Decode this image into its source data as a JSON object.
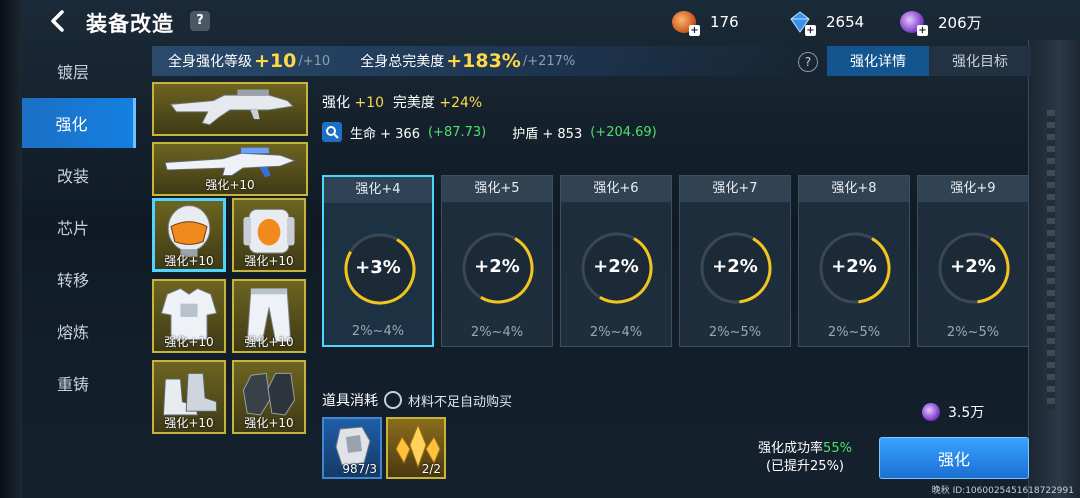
{
  "header": {
    "back_icon": "back-arrow-icon",
    "title": "装备改造",
    "help": "?",
    "currencies": [
      {
        "icon": "copper-ore-icon",
        "value": "176"
      },
      {
        "icon": "blue-crystal-icon",
        "value": "2654"
      },
      {
        "icon": "purple-orb-icon",
        "value": "206万"
      }
    ]
  },
  "sidebar": {
    "items": [
      {
        "label": "镀层"
      },
      {
        "label": "强化"
      },
      {
        "label": "改装"
      },
      {
        "label": "芯片"
      },
      {
        "label": "转移"
      },
      {
        "label": "熔炼"
      },
      {
        "label": "重铸"
      }
    ],
    "active_index": 1
  },
  "summary": {
    "level_label": "全身强化等级",
    "level_value": "+10",
    "level_max": "/+10",
    "perfect_label": "全身总完美度",
    "perfect_value": "+183%",
    "perfect_max": "/+217%"
  },
  "tabs": {
    "help": "?",
    "items": [
      {
        "label": "强化详情"
      },
      {
        "label": "强化目标"
      }
    ]
  },
  "equipment": [
    {
      "type": "rifle",
      "label": ""
    },
    {
      "type": "sniper",
      "label": "强化+10"
    },
    {
      "type": "helmet",
      "label": "强化+10"
    },
    {
      "type": "backpack",
      "label": "强化+10"
    },
    {
      "type": "armor",
      "label": "强化+10"
    },
    {
      "type": "pants",
      "label": "强化+10"
    },
    {
      "type": "boots",
      "label": "强化+10"
    },
    {
      "type": "gloves",
      "label": "强化+10"
    }
  ],
  "detail": {
    "enh_label": "强化",
    "enh_value": "+10",
    "perfect_label": "完美度",
    "perfect_value": "+24%",
    "hp_label": "生命 + 366",
    "hp_bonus": "(+87.73)",
    "shield_label": "护盾 + 853",
    "shield_bonus": "(+204.69)"
  },
  "cards": [
    {
      "title": "强化+4",
      "pct": "+3%",
      "range": "2%~4%",
      "progress": 0.75
    },
    {
      "title": "强化+5",
      "pct": "+2%",
      "range": "2%~4%",
      "progress": 0.5
    },
    {
      "title": "强化+6",
      "pct": "+2%",
      "range": "2%~4%",
      "progress": 0.5
    },
    {
      "title": "强化+7",
      "pct": "+2%",
      "range": "2%~5%",
      "progress": 0.4
    },
    {
      "title": "强化+8",
      "pct": "+2%",
      "range": "2%~5%",
      "progress": 0.4
    },
    {
      "title": "强化+9",
      "pct": "+2%",
      "range": "2%~5%",
      "progress": 0.4
    }
  ],
  "consume": {
    "label": "道具消耗",
    "auto_buy": "材料不足自动购买",
    "items": [
      {
        "icon": "armor-plate-icon",
        "count": "987/3"
      },
      {
        "icon": "gold-crystal-icon",
        "count": "2/2"
      }
    ]
  },
  "cost": {
    "icon": "purple-orb-icon",
    "value": "3.5万"
  },
  "success": {
    "label": "强化成功率",
    "rate": "55%",
    "sub": "(已提升25%)"
  },
  "enhance_button": "强化",
  "footer_id": "ID:1060025451618722991",
  "footer_name": "晚秋"
}
